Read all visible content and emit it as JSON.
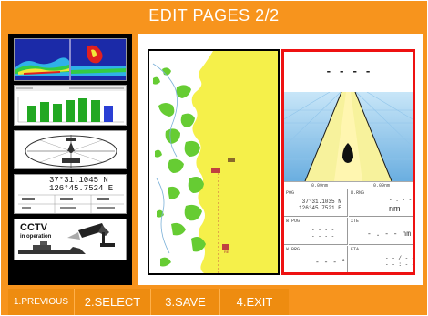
{
  "header": {
    "title": "EDIT PAGES 2/2"
  },
  "thumbnails": {
    "coord_lat": "37°31.1045 N",
    "coord_lon": "126°45.7524 E",
    "cctv_title": "CCTV",
    "cctv_subtitle": "in operation"
  },
  "preview": {
    "highway_header": "- - - -",
    "range_left": "0.09nm",
    "range_right": "0.09nm",
    "cells": [
      {
        "label": "POG",
        "value": "37°31.1035 N\n126°45.7521 E"
      },
      {
        "label": "W.RNG",
        "value": "- . - -",
        "unit": "nm"
      },
      {
        "label": "W.POG",
        "value": "- - - -\n- - - -"
      },
      {
        "label": "XTE",
        "value": "- . - - nm"
      },
      {
        "label": "W.BRG",
        "value": "- - - °"
      },
      {
        "label": "ETA",
        "value": "- - / - -\n- - : - -"
      }
    ]
  },
  "buttons": {
    "previous": "1.PREVIOUS",
    "select": "2.SELECT",
    "save": "3.SAVE",
    "exit": "4.EXIT"
  },
  "colors": {
    "accent": "#f7941d",
    "land": "#f5f04a",
    "shallow": "#66cc33",
    "highlight": "#ff0000"
  }
}
